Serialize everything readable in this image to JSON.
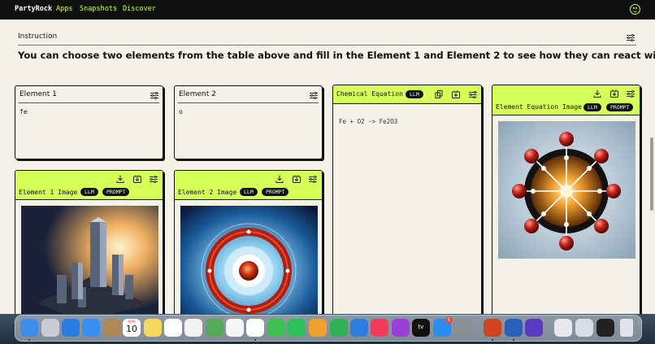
{
  "nav": {
    "brand": "PartyRock",
    "links": [
      "Apps",
      "Snapshots",
      "Discover"
    ]
  },
  "instruction": {
    "label": "Instruction",
    "text": "You can choose two elements from the table above and fill in the Element 1 and Element 2 to see how they can react with each other."
  },
  "element1": {
    "title": "Element 1",
    "value": "fe"
  },
  "element2": {
    "title": "Element 2",
    "value": "o"
  },
  "chemical_equation": {
    "title": "Chemical Equation",
    "badge": "LLM",
    "output": "Fe + O2 -> Fe2O3"
  },
  "element1_image": {
    "title": "Element 1 Image",
    "badges": [
      "LLM",
      "PROMPT"
    ]
  },
  "element2_image": {
    "title": "Element 2 Image",
    "badges": [
      "LLM",
      "PROMPT"
    ]
  },
  "equation_image": {
    "title": "Element Equation Image",
    "badges": [
      "LLM",
      "PROMPT"
    ]
  },
  "dock": {
    "calendar_month": "MAR",
    "calendar_day": "10",
    "appstore_badge": "5",
    "tv_label": "tv",
    "icons": [
      "finder-icon",
      "launchpad-icon",
      "safari-icon",
      "mail-icon",
      "contacts-icon",
      "calendar-icon",
      "notes-icon",
      "freeform-icon",
      "reminders-icon",
      "maps-icon",
      "photos-icon",
      "chrome-icon",
      "messages-icon",
      "facetime-icon",
      "pages-icon",
      "numbers-icon",
      "keynote-icon",
      "music-icon",
      "podcasts-icon",
      "appletv-icon",
      "appstore-icon",
      "settings-icon",
      "powerpoint-icon",
      "word-icon",
      "imovie-icon",
      "preview-icon",
      "finder-window-icon",
      "terminal-icon",
      "trash-icon"
    ]
  },
  "colors": {
    "accent": "#d6ff5a",
    "nav_bg": "#101010",
    "page_bg": "#f4f1e6",
    "link": "#c6ff3b"
  }
}
